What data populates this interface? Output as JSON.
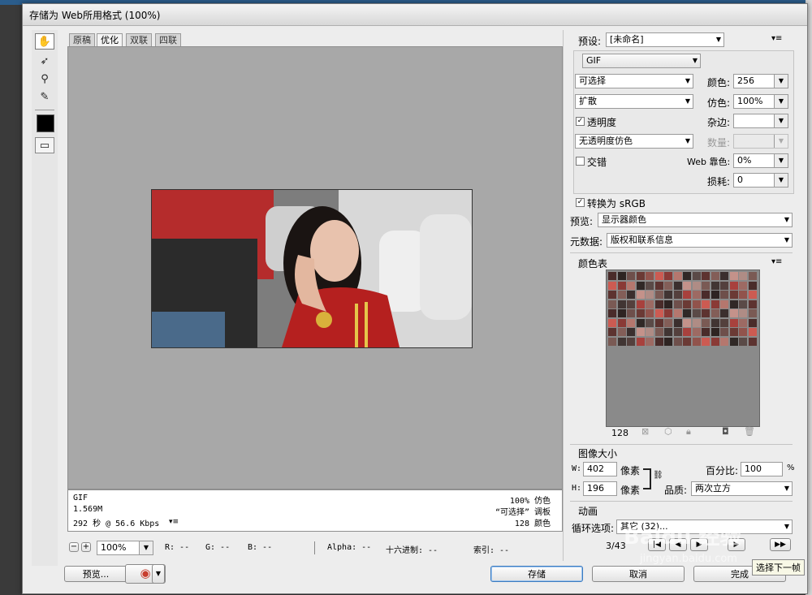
{
  "window": {
    "title": "存储为 Web所用格式 (100%)"
  },
  "tabs": [
    {
      "label": "原稿"
    },
    {
      "label": "优化"
    },
    {
      "label": "双联"
    },
    {
      "label": "四联"
    }
  ],
  "info": {
    "format": "GIF",
    "size": "1.569M",
    "time": "292 秒 @ 56.6 Kbps",
    "dither": "100% 仿色",
    "palette": "“可选择” 调板",
    "colors": "128 颜色"
  },
  "status": {
    "zoom": "100%",
    "r": "R: --",
    "g": "G: --",
    "b": "B: --",
    "alpha": "Alpha: --",
    "hex": "十六进制: --",
    "index": "索引: --"
  },
  "bottom_buttons": {
    "preview": "预览...",
    "save": "存储",
    "cancel": "取消",
    "done": "完成"
  },
  "settings": {
    "preset_label": "预设:",
    "preset_value": "[未命名]",
    "format_value": "GIF",
    "reduction_value": "可选择",
    "colors_label": "颜色:",
    "colors_value": "256",
    "dither_algo": "扩散",
    "dither_label": "仿色:",
    "dither_value": "100%",
    "transparency_label": "透明度",
    "matte_label": "杂边:",
    "trans_dither": "无透明度仿色",
    "amount_label": "数量:",
    "interlaced_label": "交错",
    "web_snap_label": "Web 靠色:",
    "web_snap_value": "0%",
    "lossy_label": "损耗:",
    "lossy_value": "0",
    "convert_srgb": "转换为 sRGB",
    "preview_label": "预览:",
    "preview_value": "显示器颜色",
    "metadata_label": "元数据:",
    "metadata_value": "版权和联系信息"
  },
  "color_table": {
    "title": "颜色表",
    "count": "128",
    "colors": [
      "#4a2c2a",
      "#6b3a35",
      "#8a3a36",
      "#5a4a47",
      "#3b2f2e",
      "#7a5a54",
      "#a8413d",
      "#2e2422",
      "#91534c",
      "#b5776e",
      "#5d3330",
      "#c4928a",
      "#413533",
      "#9d6a63",
      "#6e4f4b",
      "#cc5b52",
      "#302826",
      "#835e58",
      "#af8c85",
      "#54403d"
    ]
  },
  "image_size": {
    "title": "图像大小",
    "w_label": "W:",
    "w_value": "402",
    "h_label": "H:",
    "h_value": "196",
    "unit": "像素",
    "percent_label": "百分比:",
    "percent_value": "100",
    "percent_unit": "%",
    "quality_label": "品质:",
    "quality_value": "两次立方"
  },
  "animation": {
    "title": "动画",
    "loop_label": "循环选项:",
    "loop_value": "其它 (32)...",
    "frame": "3/43"
  },
  "tooltip": "选择下一帧",
  "watermark": "Baidu 经验",
  "watermark_url": "jingyan.baidu.com",
  "colors": {
    "accent": "#3b7bbf",
    "canvas": "#a8a8a8",
    "panel": "#ededed"
  }
}
